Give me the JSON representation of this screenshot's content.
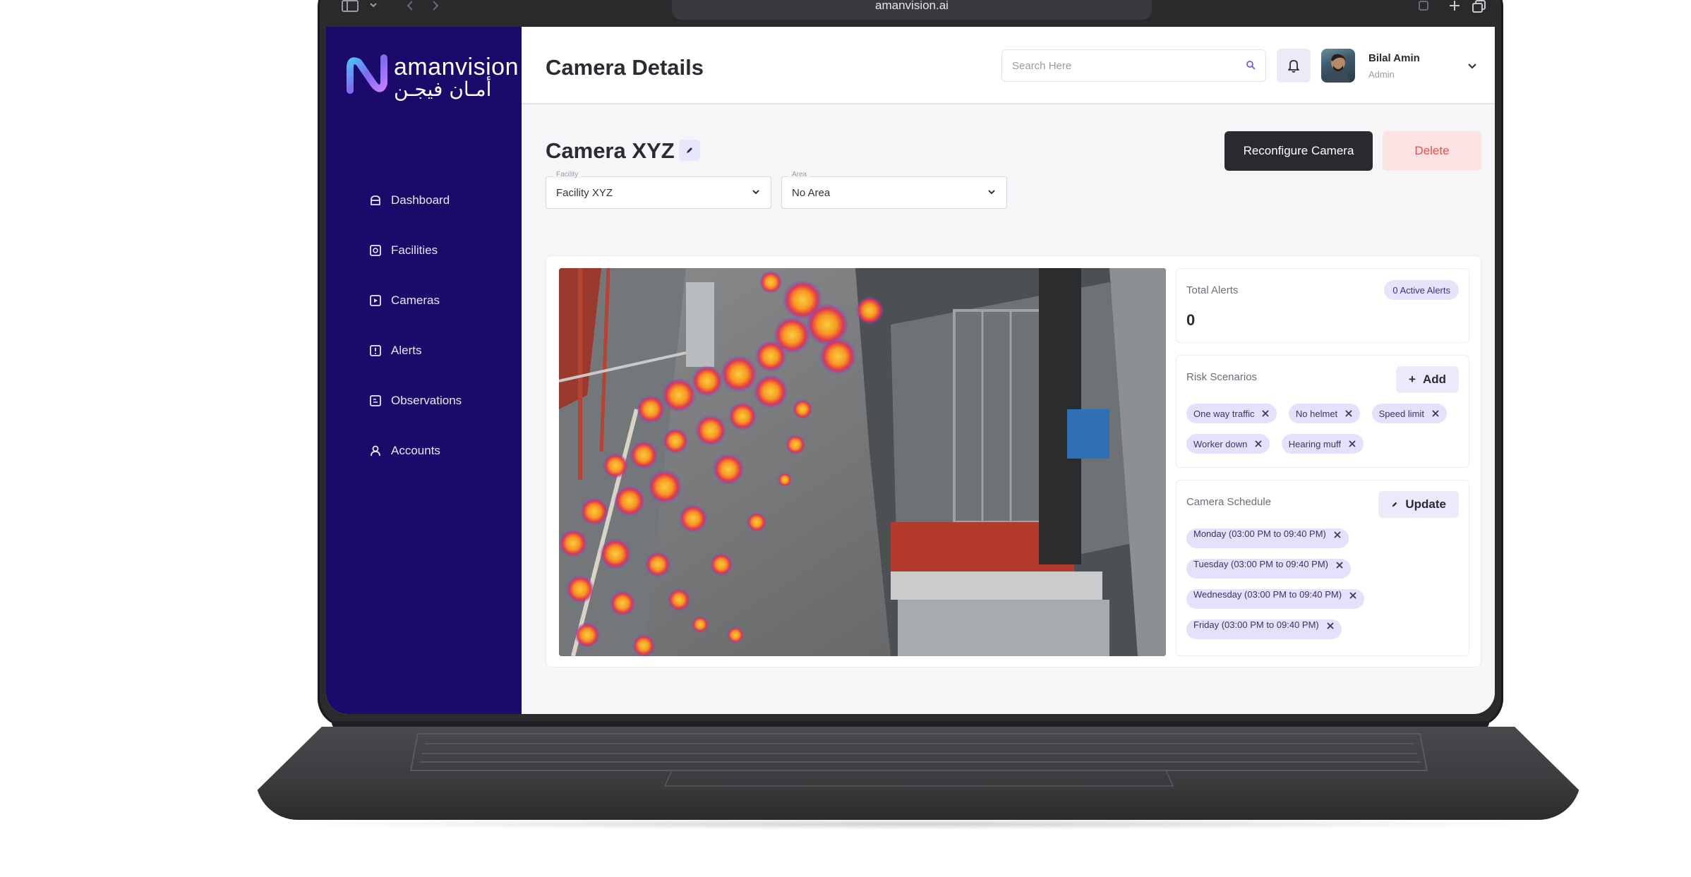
{
  "browser": {
    "url": "amanvision.ai"
  },
  "brand": {
    "name_en": "amanvision",
    "name_ar": "أمـان فيجـن",
    "sidebar_color": "#1c0a6b",
    "accent": "#7c6cf0"
  },
  "sidebar": {
    "items": [
      {
        "label": "Dashboard",
        "icon": "dashboard-icon"
      },
      {
        "label": "Facilities",
        "icon": "facility-icon"
      },
      {
        "label": "Cameras",
        "icon": "camera-icon"
      },
      {
        "label": "Alerts",
        "icon": "alert-icon"
      },
      {
        "label": "Observations",
        "icon": "observation-icon"
      },
      {
        "label": "Accounts",
        "icon": "user-icon"
      }
    ]
  },
  "header": {
    "title": "Camera Details",
    "search_placeholder": "Search Here",
    "user_name": "Bilal Amin",
    "user_role": "Admin"
  },
  "camera": {
    "name": "Camera XYZ",
    "reconfigure_label": "Reconfigure Camera",
    "delete_label": "Delete",
    "facility": {
      "label": "Facility",
      "value": "Facility XYZ"
    },
    "area": {
      "label": "Area",
      "value": "No Area"
    }
  },
  "alerts_card": {
    "title": "Total Alerts",
    "badge": "0 Active Alerts",
    "count": "0"
  },
  "risk_card": {
    "title": "Risk Scenarios",
    "add_label": "Add",
    "chips": [
      "One way traffic",
      "No helmet",
      "Speed limit",
      "Worker down",
      "Hearing muff"
    ]
  },
  "schedule_card": {
    "title": "Camera Schedule",
    "update_label": "Update",
    "chips": [
      "Monday (03:00 PM to 09:40 PM)",
      "Tuesday (03:00 PM to 09:40 PM)",
      "Wednesday (03:00 PM to 09:40 PM)",
      "Friday (03:00 PM to 09:40 PM)"
    ]
  }
}
